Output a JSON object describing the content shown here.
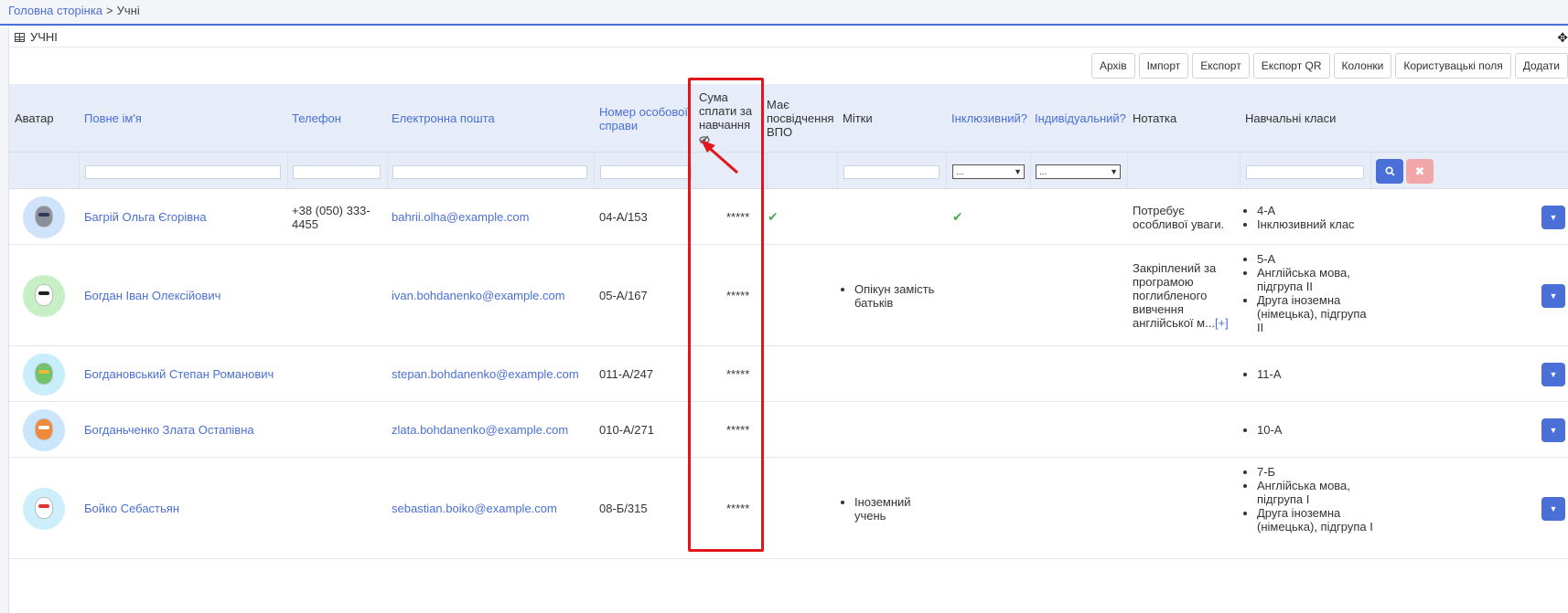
{
  "breadcrumb": {
    "home": "Головна сторінка",
    "separator": ">",
    "current": "Учні"
  },
  "panel": {
    "title": "УЧНІ"
  },
  "toolbar": [
    "Архів",
    "Імпорт",
    "Експорт",
    "Експорт QR",
    "Колонки",
    "Користувацькі поля",
    "Додати"
  ],
  "columns": {
    "avatar": "Аватар",
    "full_name": "Повне ім'я",
    "phone": "Телефон",
    "email": "Електронна пошта",
    "file_number": "Номер особової справи",
    "tuition": "Сума сплати за навчання",
    "vpo": "Має посвідчення ВПО",
    "tags": "Мітки",
    "inclusive": "Інклюзивний?",
    "individual": "Індивідуальний?",
    "note": "Нотатка",
    "classes": "Навчальні класи"
  },
  "filters": {
    "inclusive_value": "...",
    "individual_value": "..."
  },
  "colors": {
    "accent": "#4a6fd6",
    "header_bg": "#e6ecf8",
    "highlight": "#e4141b",
    "check": "#4caf50"
  },
  "rows": [
    {
      "avatar": "raccoon-avatar",
      "name": "Багрій Ольга Єгорівна",
      "phone": "+38 (050) 333-4455",
      "email": "bahrii.olha@example.com",
      "file_number": "04-А/153",
      "tuition": "*****",
      "vpo": true,
      "tags": [],
      "inclusive": true,
      "note": "Потребує особливої уваги.",
      "classes": [
        "4-А",
        "Інклюзивний клас"
      ]
    },
    {
      "avatar": "panda-avatar",
      "name": "Богдан Іван Олексійович",
      "phone": "",
      "email": "ivan.bohdanenko@example.com",
      "file_number": "05-А/167",
      "tuition": "*****",
      "vpo": false,
      "tags": [
        "Опікун замість батьків"
      ],
      "inclusive": false,
      "note": "Закріплений за програмою поглибленого вивчення англійської м...",
      "note_more": "[+]",
      "classes": [
        "5-А",
        "Англійська мова, підгрупа II",
        "Друга іноземна (німецька), підгрупа II"
      ]
    },
    {
      "avatar": "dinosaur-avatar",
      "name": "Богдановський Степан Романович",
      "phone": "",
      "email": "stepan.bohdanenko@example.com",
      "file_number": "011-А/247",
      "tuition": "*****",
      "vpo": false,
      "tags": [],
      "inclusive": false,
      "note": "",
      "classes": [
        "11-А"
      ]
    },
    {
      "avatar": "fox-avatar",
      "name": "Богданьченко Злата Остапівна",
      "phone": "",
      "email": "zlata.bohdanenko@example.com",
      "file_number": "010-А/271",
      "tuition": "*****",
      "vpo": false,
      "tags": [],
      "inclusive": false,
      "note": "",
      "classes": [
        "10-А"
      ]
    },
    {
      "avatar": "snowman-avatar",
      "name": "Бойко Себастьян",
      "phone": "",
      "email": "sebastian.boiko@example.com",
      "file_number": "08-Б/315",
      "tuition": "*****",
      "vpo": false,
      "tags": [
        "Іноземний учень"
      ],
      "inclusive": false,
      "note": "",
      "classes": [
        "7-Б",
        "Англійська мова, підгрупа I",
        "Друга іноземна (німецька), підгрупа I"
      ]
    }
  ]
}
